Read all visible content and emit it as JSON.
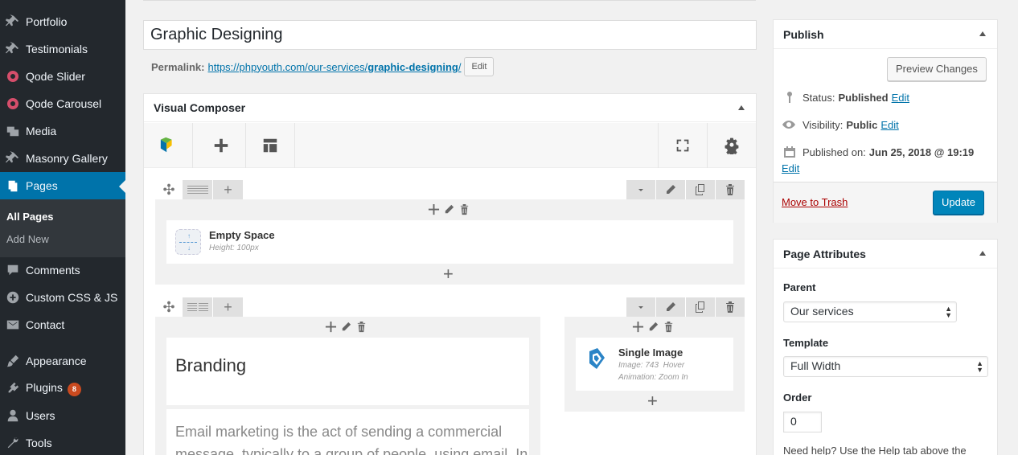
{
  "sidebar": {
    "items": [
      {
        "label": "Portfolio",
        "icon": "pin-icon"
      },
      {
        "label": "Testimonials",
        "icon": "pin-icon"
      },
      {
        "label": "Qode Slider",
        "icon": "qode-circle-icon"
      },
      {
        "label": "Qode Carousel",
        "icon": "qode-circle-icon"
      },
      {
        "label": "Media",
        "icon": "media-icon"
      },
      {
        "label": "Masonry Gallery",
        "icon": "pin-icon"
      },
      {
        "label": "Pages",
        "icon": "pages-icon"
      },
      {
        "label": "Comments",
        "icon": "comment-icon"
      },
      {
        "label": "Custom CSS & JS",
        "icon": "plus-circle-icon"
      },
      {
        "label": "Contact",
        "icon": "mail-icon"
      },
      {
        "label": "Appearance",
        "icon": "brush-icon"
      },
      {
        "label": "Plugins",
        "icon": "plugin-icon",
        "badge": "8"
      },
      {
        "label": "Users",
        "icon": "user-icon"
      },
      {
        "label": "Tools",
        "icon": "wrench-icon"
      }
    ],
    "submenu": [
      "All Pages",
      "Add New"
    ]
  },
  "post": {
    "title": "Graphic Designing",
    "permalink_label": "Permalink:",
    "permalink_base": "https://phpyouth.com/our-services/",
    "permalink_slug": "graphic-designing",
    "permalink_end": "/",
    "edit_label": "Edit"
  },
  "vc": {
    "title": "Visual Composer",
    "row1": {
      "element_title": "Empty Space",
      "element_sub": "Height: 100px"
    },
    "row2": {
      "heading": "Branding",
      "text_line1": "Email marketing is the act of sending a commercial",
      "text_line2": "message, typically to a group of people, using email. In",
      "image_title": "Single Image",
      "image_sub1": "Image: 743  Hover",
      "image_sub2": "Animation: Zoom In"
    }
  },
  "publish": {
    "title": "Publish",
    "preview_label": "Preview Changes",
    "status_label": "Status:",
    "status_value": "Published",
    "visibility_label": "Visibility:",
    "visibility_value": "Public",
    "published_label": "Published on:",
    "published_value": "Jun 25, 2018 @ 19:19",
    "edit_label": "Edit",
    "trash_label": "Move to Trash",
    "update_label": "Update"
  },
  "attributes": {
    "title": "Page Attributes",
    "parent_label": "Parent",
    "parent_value": "Our services",
    "template_label": "Template",
    "template_value": "Full Width",
    "order_label": "Order",
    "order_value": "0",
    "help_text": "Need help? Use the Help tab above the"
  }
}
